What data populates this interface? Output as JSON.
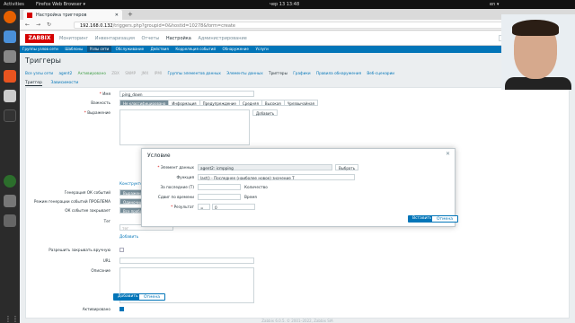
{
  "os": {
    "activities": "Activities",
    "app_name": "Firefox Web Browser ▾",
    "clock": "чер 13  13:48",
    "tray": "en ▾"
  },
  "browser": {
    "tab_title": "Настройка триггеров",
    "url_host": "192.168.0.132",
    "url_path": "/triggers.php?groupid=0&hostid=10278&form=create"
  },
  "zabbix": {
    "logo": "ZABBIX",
    "menu": [
      "Мониторинг",
      "Инвентаризация",
      "Отчеты",
      "Настройка",
      "Администрирование"
    ],
    "submenu": [
      "Группы узлов сети",
      "Шаблоны",
      "Узлы сети",
      "Обслуживание",
      "Действия",
      "Корреляция событий",
      "Обнаружение",
      "Услуги"
    ],
    "page_title": "Триггеры",
    "breadcrumbs": [
      "Все узлы сети",
      "agent2",
      "Активировано",
      "ZBX",
      "SNMP",
      "JMX",
      "IPMI",
      "Группы элементов данных",
      "Элементы данных",
      "Триггеры",
      "Графики",
      "Правила обнаружения",
      "Веб-сценарии"
    ],
    "form_tabs": [
      "Триггер",
      "Зависимости"
    ],
    "form": {
      "name_label": "Имя",
      "name_value": "ping_down",
      "severity_label": "Важность",
      "severity": [
        "Не классифицировано",
        "Информация",
        "Предупреждение",
        "Средняя",
        "Высокая",
        "Чрезвычайная"
      ],
      "expression_label": "Выражение",
      "add_button": "Добавить",
      "constructor_link": "Конструктор выр",
      "ok_gen_label": "Генерация ОК событий",
      "ok_gen_value": "Выражение",
      "problem_mode_label": "Режим генерации событий ПРОБЛЕМА",
      "problem_mode_value": "Одиночный",
      "ok_closes_label": "ОК событие закрывает",
      "ok_closes_value": "Все проблемы",
      "tags_label": "Тег",
      "tag_placeholder": "тег",
      "tag_add": "Добавить",
      "manual_close_label": "Разрешить закрывать вручную",
      "url_label": "URL",
      "description_label": "Описание",
      "enabled_label": "Активировано",
      "submit": "Добавить",
      "cancel": "Отмена"
    },
    "footer": "Zabbix 6.0.5. © 2001–2022, Zabbix SIA"
  },
  "modal": {
    "title": "Условие",
    "item_label": "Элемент данных",
    "item_value": "agent2: icmpping",
    "select_button": "Выбрать",
    "function_label": "Функция",
    "function_value": "last() - Последнее (наиболее новое) значение T",
    "last_label": "За последние (T)",
    "last_unit": "Количество",
    "shift_label": "Сдвиг по времени",
    "shift_unit": "Время",
    "result_label": "Результат",
    "result_op": "=",
    "result_value": "0",
    "insert_button": "Вставить",
    "cancel_button": "Отмена"
  }
}
